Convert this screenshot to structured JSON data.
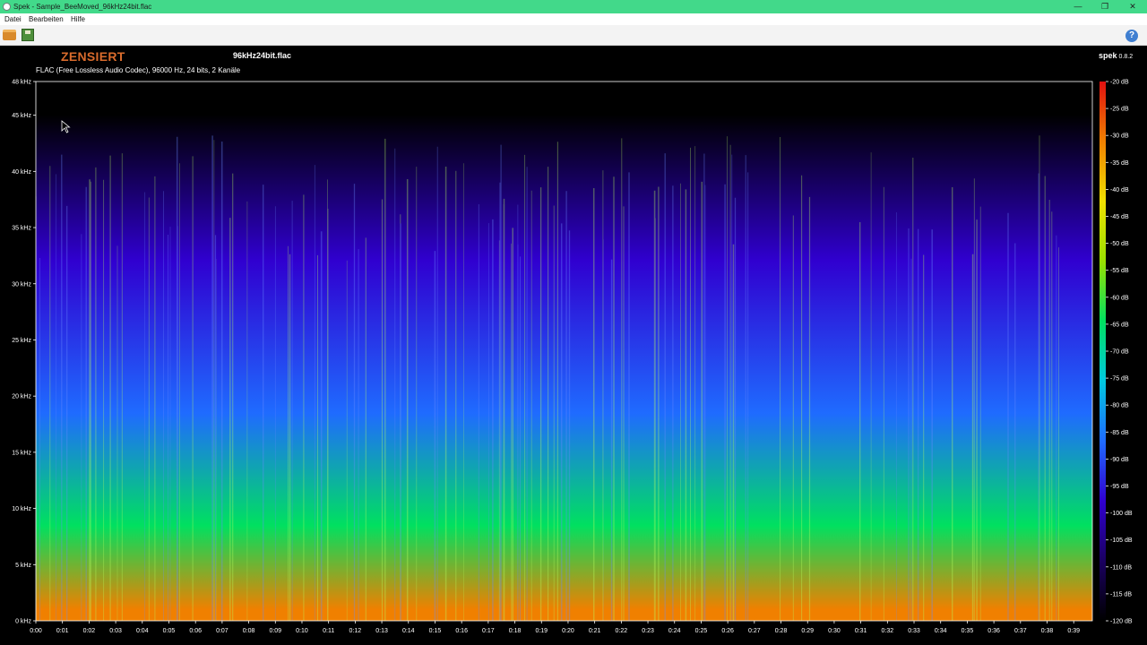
{
  "window": {
    "title": "Spek - Sample_BeeMoved_96kHz24bit.flac",
    "minimize_label": "—",
    "maximize_label": "❐",
    "close_label": "✕"
  },
  "menu": {
    "items": [
      "Datei",
      "Bearbeiten",
      "Hilfe"
    ]
  },
  "toolbar": {
    "open_icon": "folder-open-icon",
    "save_icon": "save-image-icon",
    "help_icon": "help-icon",
    "help_label": "?"
  },
  "header": {
    "watermark": "ZENSIERT",
    "file_name": "96kHz24bit.flac",
    "app_name": "spek",
    "app_version": "0.8.2",
    "file_info": "FLAC (Free Lossless Audio Codec), 96000 Hz, 24 bits, 2 Kanäle"
  },
  "colors": {
    "title_bar": "#42d98a",
    "watermark": "#d96b2c",
    "background": "#000000"
  },
  "chart_data": {
    "type": "heatmap",
    "title": "",
    "xlabel": "",
    "ylabel": "",
    "x_ticks": [
      "0:00",
      "0:01",
      "0:02",
      "0:03",
      "0:04",
      "0:05",
      "0:06",
      "0:07",
      "0:08",
      "0:09",
      "0:10",
      "0:11",
      "0:12",
      "0:13",
      "0:14",
      "0:15",
      "0:16",
      "0:17",
      "0:18",
      "0:19",
      "0:20",
      "0:21",
      "0:22",
      "0:23",
      "0:24",
      "0:25",
      "0:26",
      "0:27",
      "0:28",
      "0:29",
      "0:30",
      "0:31",
      "0:32",
      "0:33",
      "0:34",
      "0:35",
      "0:36",
      "0:37",
      "0:38",
      "0:39"
    ],
    "y_ticks": [
      "0 kHz",
      "5 kHz",
      "10 kHz",
      "15 kHz",
      "20 kHz",
      "25 kHz",
      "30 kHz",
      "35 kHz",
      "40 kHz",
      "45 kHz",
      "48 kHz"
    ],
    "y_values_khz": [
      0,
      5,
      10,
      15,
      20,
      25,
      30,
      35,
      40,
      45,
      48
    ],
    "x_range_seconds": [
      0,
      39.7
    ],
    "y_range_khz": [
      0,
      48
    ],
    "colorbar_ticks": [
      "-20 dB",
      "-25 dB",
      "-30 dB",
      "-35 dB",
      "-40 dB",
      "-45 dB",
      "-50 dB",
      "-55 dB",
      "-60 dB",
      "-65 dB",
      "-70 dB",
      "-75 dB",
      "-80 dB",
      "-85 dB",
      "-90 dB",
      "-95 dB",
      "-100 dB",
      "-105 dB",
      "-110 dB",
      "-115 dB",
      "-120 dB"
    ],
    "colorbar_range_db": [
      -120,
      -20
    ],
    "colormap": [
      "#000000",
      "#1a0060",
      "#3000d0",
      "#1f6bff",
      "#00c8e0",
      "#00e060",
      "#9ae000",
      "#f0e000",
      "#f08000",
      "#e01010"
    ],
    "energy_profile": [
      {
        "freq_range_khz": [
          0,
          2
        ],
        "level_db": -30
      },
      {
        "freq_range_khz": [
          2,
          15
        ],
        "level_db": -65
      },
      {
        "freq_range_khz": [
          15,
          22
        ],
        "level_db": -85
      },
      {
        "freq_range_khz": [
          22,
          42
        ],
        "level_db": -100
      },
      {
        "freq_range_khz": [
          42,
          48
        ],
        "level_db": -120
      }
    ]
  }
}
